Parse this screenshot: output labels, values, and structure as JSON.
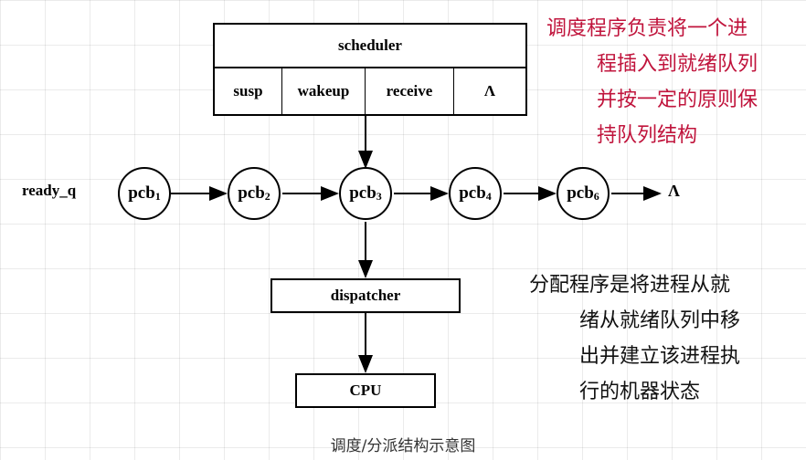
{
  "scheduler": {
    "title": "scheduler",
    "cells": [
      "susp",
      "wakeup",
      "receive",
      "Λ"
    ]
  },
  "queue": {
    "label": "ready_q",
    "nodes": [
      {
        "base": "pcb",
        "sub": "1"
      },
      {
        "base": "pcb",
        "sub": "2"
      },
      {
        "base": "pcb",
        "sub": "3"
      },
      {
        "base": "pcb",
        "sub": "4"
      },
      {
        "base": "pcb",
        "sub": "6"
      }
    ],
    "end": "Λ"
  },
  "dispatcher": {
    "label": "dispatcher"
  },
  "cpu": {
    "label": "CPU"
  },
  "notes": {
    "scheduler_note": [
      "调度程序负责将一个进",
      "程插入到就绪队列",
      "并按一定的原则保",
      "持队列结构"
    ],
    "dispatcher_note": [
      "分配程序是将进程从就",
      "绪从就绪队列中移",
      "出并建立该进程执",
      "行的机器状态"
    ]
  },
  "caption": "调度/分派结构示意图",
  "colors": {
    "scheduler_note": "#c0143c",
    "dispatcher_note": "#000000",
    "lines": "#000000"
  }
}
